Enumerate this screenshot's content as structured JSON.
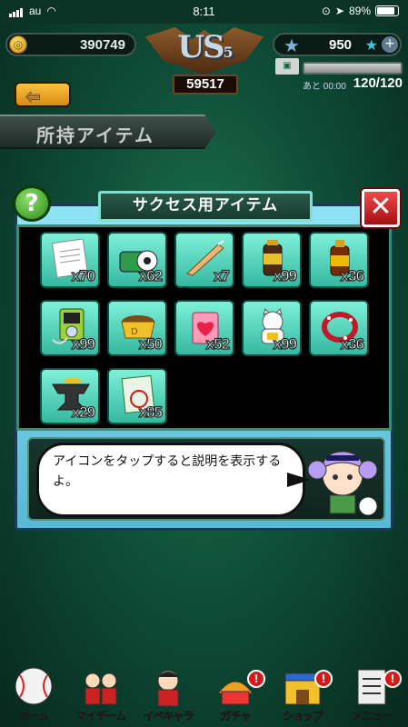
{
  "status_bar": {
    "carrier": "au",
    "time": "8:11",
    "battery": "89%"
  },
  "hud": {
    "coins": "390749",
    "emblem_text": "US",
    "emblem_sub": "5",
    "rank_points": "59517",
    "stars": "950",
    "stamina_timer": "あと 00:00",
    "stamina_count": "120/120",
    "stamina_fill_fraction": 1.0
  },
  "page_title": "所持アイテム",
  "panel": {
    "title": "サクセス用アイテム",
    "help_label": "?",
    "close_label": "✕",
    "items": [
      {
        "name": "entry-form",
        "qty": "x70"
      },
      {
        "name": "ball-bag",
        "qty": "x62"
      },
      {
        "name": "knife",
        "qty": "x7"
      },
      {
        "name": "energy-drink",
        "qty": "x99"
      },
      {
        "name": "power-drink",
        "qty": "x36"
      },
      {
        "name": "music-player",
        "qty": "x99"
      },
      {
        "name": "food-bowl",
        "qty": "x50"
      },
      {
        "name": "heart-charm",
        "qty": "x52"
      },
      {
        "name": "lucky-cat",
        "qty": "x99"
      },
      {
        "name": "bracelet",
        "qty": "x36"
      },
      {
        "name": "anvil",
        "qty": "x29"
      },
      {
        "name": "practice-book",
        "qty": "x85"
      }
    ],
    "book_label": "練習"
  },
  "dialog": {
    "text": "アイコンをタップすると説明を表示するよ。"
  },
  "nav": [
    {
      "label": "ホーム",
      "badge": ""
    },
    {
      "label": "マイチーム",
      "badge": ""
    },
    {
      "label": "イベキャラ",
      "badge": ""
    },
    {
      "label": "ガチャ",
      "badge": "!"
    },
    {
      "label": "ショップ",
      "badge": "!"
    },
    {
      "label": "メニュー",
      "badge": "!"
    }
  ],
  "colors": {
    "accent": "#58b9d6",
    "item_bg": "#36b8a0",
    "close": "#d61a1a"
  }
}
